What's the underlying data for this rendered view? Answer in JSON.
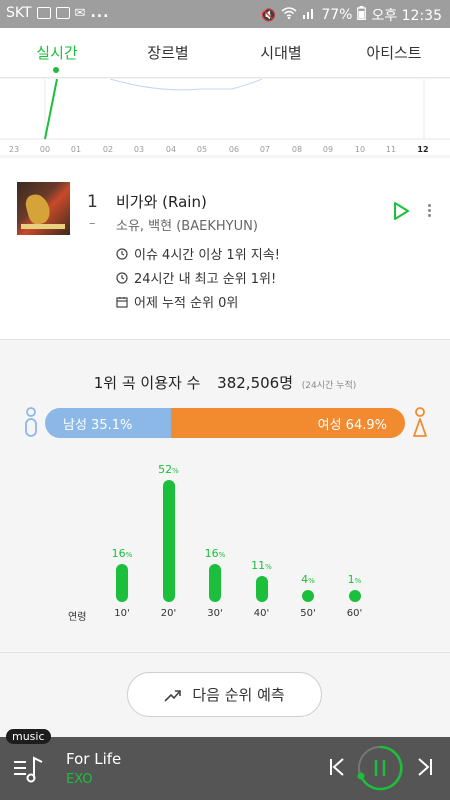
{
  "status_bar": {
    "carrier": "SKT",
    "more": "...",
    "battery": "77%",
    "time": "오후 12:35"
  },
  "tabs": [
    {
      "label": "실시간",
      "active": true
    },
    {
      "label": "장르별",
      "active": false
    },
    {
      "label": "시대별",
      "active": false
    },
    {
      "label": "아티스트",
      "active": false
    }
  ],
  "timeline": {
    "hours": [
      "23",
      "00",
      "01",
      "02",
      "03",
      "04",
      "05",
      "06",
      "07",
      "08",
      "09",
      "10",
      "11",
      "12"
    ],
    "current_hour": "12"
  },
  "song": {
    "rank": "1",
    "rank_change": "–",
    "title": "비가와 (Rain)",
    "artist": "소유, 백현 (BAEKHYUN)",
    "facts": [
      {
        "icon": "clock-icon",
        "text": "이슈 4시간 이상 1위 지속!"
      },
      {
        "icon": "clock-icon",
        "text": "24시간 내 최고 순위 1위!"
      },
      {
        "icon": "calendar-icon",
        "text": "어제 누적 순위 0위"
      }
    ]
  },
  "stats": {
    "label": "1위 곡 이용자 수",
    "count": "382,506명",
    "note": "(24시간 누적)",
    "gender": {
      "male_label": "남성 35.1%",
      "male_pct": 35.1,
      "female_label": "여성 64.9%",
      "female_pct": 64.9
    }
  },
  "chart_data": {
    "type": "bar",
    "xlabel": "연령",
    "categories": [
      "10'",
      "20'",
      "30'",
      "40'",
      "50'",
      "60'"
    ],
    "values": [
      16,
      52,
      16,
      11,
      4,
      1
    ],
    "unit": "%",
    "color": "#1bbf3b"
  },
  "predict_button": {
    "label": "다음 순위 예측"
  },
  "player": {
    "tag": "music",
    "title": "For Life",
    "artist": "EXO"
  },
  "colors": {
    "accent": "#1bbf3b",
    "male": "#8cb8e8",
    "female": "#f28a30"
  }
}
